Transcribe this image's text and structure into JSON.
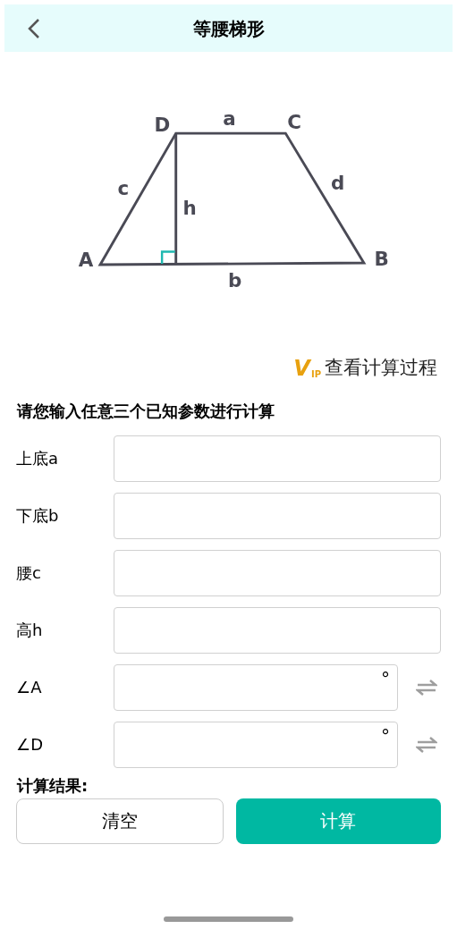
{
  "header": {
    "title": "等腰梯形"
  },
  "diagram": {
    "labels": {
      "A": "A",
      "B": "B",
      "C": "C",
      "D": "D",
      "a": "a",
      "b": "b",
      "c": "c",
      "d": "d",
      "h": "h"
    }
  },
  "vip_link": {
    "badge_main": "V",
    "badge_sub": "IP",
    "label": "查看计算过程"
  },
  "prompt": "请您输入任意三个已知参数进行计算",
  "fields": [
    {
      "kind": "length",
      "label": "上底a"
    },
    {
      "kind": "length",
      "label": "下底b"
    },
    {
      "kind": "length",
      "label": "腰c"
    },
    {
      "kind": "length",
      "label": "高h"
    },
    {
      "kind": "angle",
      "label": "∠A",
      "unit": "°"
    },
    {
      "kind": "angle",
      "label": "∠D",
      "unit": "°"
    }
  ],
  "result_label": "计算结果:",
  "buttons": [
    {
      "kind": "secondary",
      "label": "清空"
    },
    {
      "kind": "primary",
      "label": "计算"
    }
  ]
}
